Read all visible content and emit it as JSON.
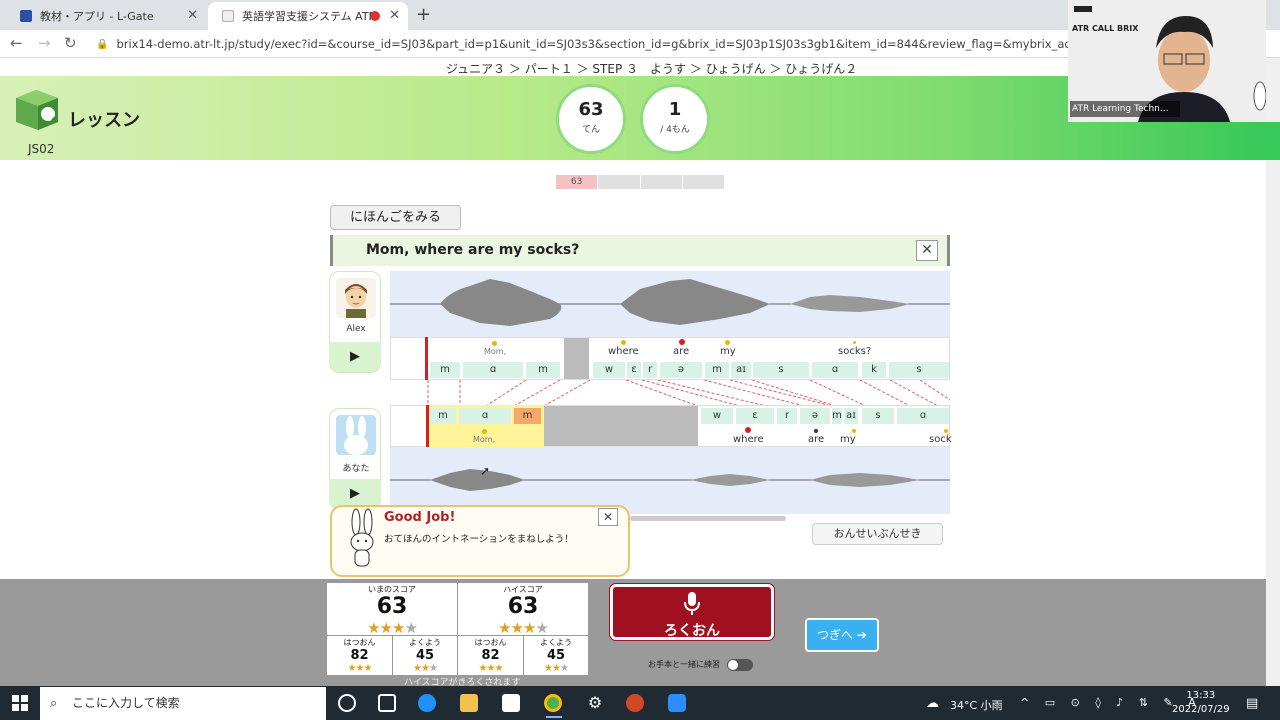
{
  "browser": {
    "tabs": [
      {
        "title": "教材・アプリ - L-Gate",
        "active": false
      },
      {
        "title": "英語学習支援システム ATR CA",
        "active": true
      }
    ],
    "url": "brix14-demo.atr-lt.jp/study/exec?id=&course_id=SJ03&part_id=p1&unit_id=SJ03s3&section_id=g&brix_id=SJ03p1SJ03s3gb1&item_id=844&review_flag=&mybrix_add_max=0&custom"
  },
  "breadcrumb": "ジュニア３ ＞ パート１ ＞ STEP ３　ようす ＞ ひょうげん ＞ ひょうげん２",
  "lesson": {
    "title": "レッスン",
    "code": "JS02"
  },
  "score_circle": {
    "value": "63",
    "unit": "てん"
  },
  "question_circle": {
    "value": "1",
    "unit": "/ 4もん"
  },
  "progress": {
    "first_value": "63"
  },
  "japanese_button": "にほんごをみる",
  "sentence": "Mom, where are my socks?",
  "model": {
    "speaker": "Alex",
    "words": [
      "Mom,",
      "where",
      "are",
      "my",
      "socks?"
    ],
    "phones": [
      "m",
      "ɑ",
      "m",
      "w",
      "ɛ",
      "r",
      "ə",
      "m",
      "aɪ",
      "s",
      "ɑ",
      "k",
      "s"
    ]
  },
  "user": {
    "speaker": "あなた",
    "words": [
      "Mom,",
      "where",
      "are",
      "my",
      "sock"
    ],
    "phones": [
      "m",
      "ɑ",
      "m",
      "w",
      "ɛ",
      "r",
      "ə",
      "m",
      "aɪ",
      "s",
      "ɑ"
    ]
  },
  "feedback": {
    "title": "Good Job!",
    "message": "おてほんのイントネーションをまねしよう！"
  },
  "analysis_button": "おんせいぶんせき",
  "scores": {
    "current": {
      "label": "いまのスコア",
      "value": "63",
      "pron_label": "はつおん",
      "pron": "82",
      "inton_label": "よくよう",
      "inton": "45"
    },
    "high": {
      "label": "ハイスコア",
      "value": "63",
      "pron_label": "はつおん",
      "pron": "82",
      "inton_label": "よくよう",
      "inton": "45"
    }
  },
  "record_button": "ろくおん",
  "next_button": "つぎへ",
  "practice_label": "お手本と一緒に練習",
  "highscore_note": "ハイスコアがきろくされます",
  "webcam": {
    "brand": "ATR CALL BRIX",
    "caption": "ATR Learning Techn..."
  },
  "taskbar": {
    "search_placeholder": "ここに入力して検索",
    "weather": "34°C 小雨",
    "time": "13:33",
    "date": "2022/07/29"
  },
  "colors": {
    "green": "#39c85a",
    "record": "#a01020",
    "next": "#3ab0f0",
    "pitch_red": "#d62020"
  }
}
